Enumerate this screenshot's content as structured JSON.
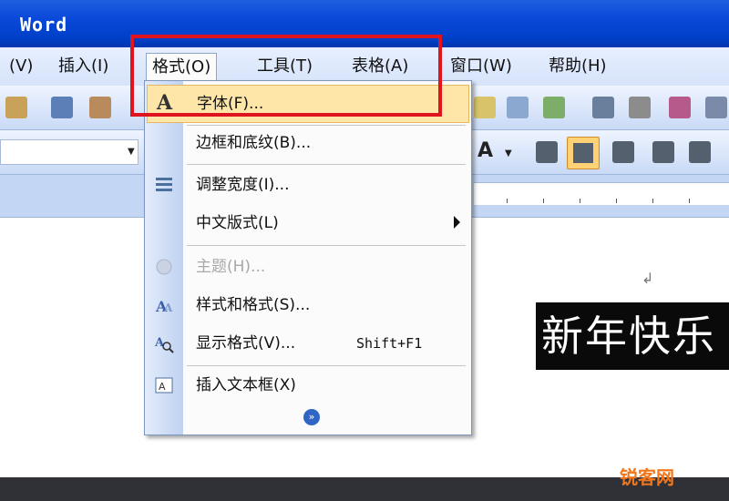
{
  "window": {
    "title": "Word"
  },
  "menubar": {
    "items": [
      {
        "label": "(V)"
      },
      {
        "label": "插入(I)"
      },
      {
        "label": "格式(O)"
      },
      {
        "label": "工具(T)"
      },
      {
        "label": "表格(A)"
      },
      {
        "label": "窗口(W)"
      },
      {
        "label": "帮助(H)"
      }
    ]
  },
  "format_menu": {
    "items": [
      {
        "label": "字体(F)...",
        "icon": "font-A-icon",
        "state": "highlighted"
      },
      {
        "label": "边框和底纹(B)...",
        "icon": "",
        "state": "enabled"
      },
      {
        "label": "调整宽度(I)...",
        "icon": "fit-width-icon",
        "state": "enabled"
      },
      {
        "label": "中文版式(L)",
        "icon": "",
        "state": "enabled",
        "submenu": true
      },
      {
        "label": "主题(H)...",
        "icon": "theme-icon",
        "state": "disabled"
      },
      {
        "label": "样式和格式(S)...",
        "icon": "styles-icon",
        "state": "enabled"
      },
      {
        "label": "显示格式(V)...",
        "shortcut": "Shift+F1",
        "icon": "reveal-format-icon",
        "state": "enabled"
      },
      {
        "label": "插入文本框(X)",
        "icon": "textbox-icon",
        "state": "enabled"
      }
    ],
    "expand_label": "»"
  },
  "document": {
    "paragraph_mark": "↲",
    "selected_text": "新年快乐"
  },
  "colors": {
    "titlebar": "#0a48d8",
    "highlight_box": "#e0141e",
    "menu_highlight": "#fde6a8",
    "watermark": "#f2761c"
  },
  "watermark": {
    "text": "锐客网"
  }
}
